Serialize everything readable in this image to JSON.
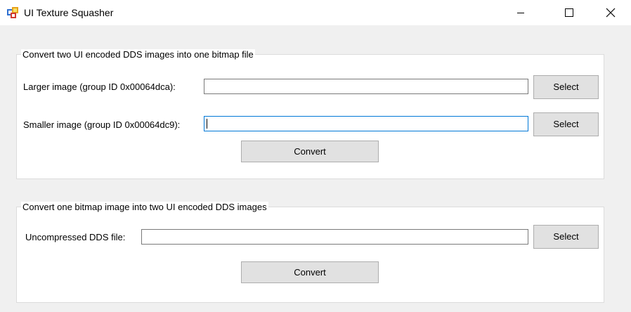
{
  "window": {
    "title": "UI Texture Squasher",
    "controls": {
      "minimize": "minimize-icon",
      "maximize": "maximize-icon",
      "close": "close-icon"
    }
  },
  "group_combine": {
    "legend": "Convert two UI encoded DDS images into one bitmap file",
    "larger_label": "Larger image (group ID 0x00064dca):",
    "larger_value": "",
    "larger_select": "Select",
    "smaller_label": "Smaller image (group ID 0x00064dc9):",
    "smaller_value": "",
    "smaller_select": "Select",
    "convert": "Convert"
  },
  "group_split": {
    "legend": "Convert one bitmap image into two UI encoded DDS images",
    "file_label": "Uncompressed DDS file:",
    "file_value": "",
    "file_select": "Select",
    "convert": "Convert"
  }
}
